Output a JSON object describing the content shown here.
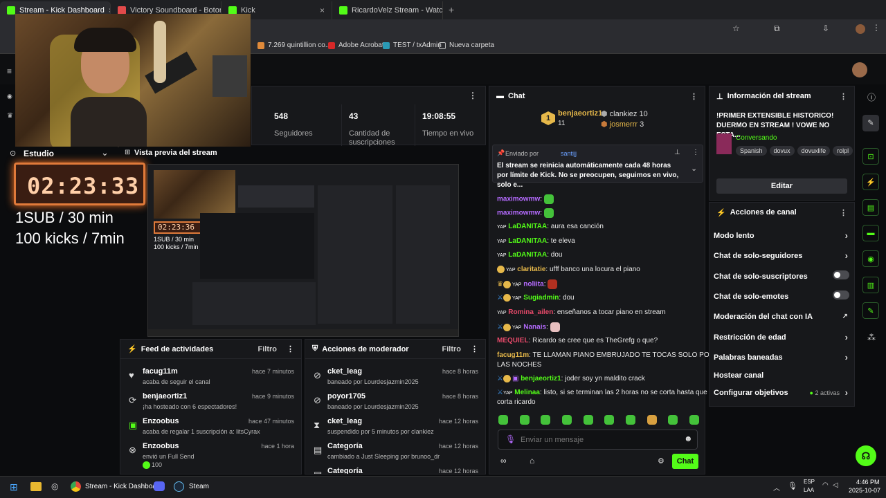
{
  "browser": {
    "tabs": [
      {
        "title": "Stream - Kick Dashboard",
        "active": true
      },
      {
        "title": "Victory Soundboard - Botones",
        "active": false
      },
      {
        "title": "Kick",
        "active": false
      },
      {
        "title": "RicardoVelz Stream - Watch",
        "active": false
      }
    ],
    "bookmarks": [
      "7.269 quintillion co...",
      "Adobe Acrobat",
      "TEST / txAdmin",
      "Nueva carpeta"
    ]
  },
  "stats": {
    "followers_value": "548",
    "followers_label": "Seguidores",
    "subs_value": "43",
    "subs_label": "Cantidad de suscripciones",
    "live_value": "19:08:55",
    "live_label": "Tiempo en vivo"
  },
  "overlay": {
    "studio_label": "Estudio",
    "preview_title": "Vista previa del stream",
    "timer": "02:23:33",
    "line1": "1SUB / 30 min",
    "line2": "100 kicks / 7min",
    "mini_timer": "02:23:36",
    "mini_line1": "1SUB / 30 min",
    "mini_line2": "100 kicks / 7min"
  },
  "activity_feed": {
    "title": "Feed de actividades",
    "filter": "Filtro",
    "items": [
      {
        "icon": "heart-icon",
        "user": "facug11m",
        "text": "acaba de seguir el canal",
        "time": "hace 7 minutos"
      },
      {
        "icon": "host-icon",
        "user": "benjaeortiz1",
        "text": "¡ha hosteado con 6 espectadores!",
        "time": "hace 9 minutos"
      },
      {
        "icon": "gift-icon",
        "user": "Enzoobus",
        "text": "acaba de regalar 1 suscripción a: litsCyrax",
        "time": "hace 47 minutos"
      },
      {
        "icon": "kick-icon",
        "user": "Enzoobus",
        "text": "envió un Full Send",
        "extra": "100",
        "time": "hace 1 hora"
      }
    ]
  },
  "mod_actions": {
    "title": "Acciones de moderador",
    "filter": "Filtro",
    "items": [
      {
        "icon": "ban-icon",
        "user": "cket_leag",
        "text": "baneado por Lourdesjazmin2025",
        "time": "hace 8 horas"
      },
      {
        "icon": "ban-icon",
        "user": "poyor1705",
        "text": "baneado por Lourdesjazmin2025",
        "time": "hace 8 horas"
      },
      {
        "icon": "hourglass-icon",
        "user": "cket_leag",
        "text": "suspendido por 5 minutos por clankiez",
        "time": "hace 12 horas"
      },
      {
        "icon": "category-icon",
        "user": "Categoría",
        "text": "cambiado a Just Sleeping por brunoo_dr",
        "time": "hace 12 horas"
      },
      {
        "icon": "category-icon",
        "user": "Categoría",
        "text": "",
        "time": "hace 12 horas"
      }
    ]
  },
  "chat": {
    "title": "Chat",
    "top_gifters": [
      {
        "rank": "1",
        "name": "benjaeortiz1",
        "count": "11"
      },
      {
        "rank": "",
        "name": "clankiez",
        "count": "10"
      },
      {
        "rank": "",
        "name": "josmerrr",
        "count": "3"
      }
    ],
    "pinned_by_label": "Enviado por",
    "pinned_by": "santijj",
    "pinned_text": "El stream se reinicia automáticamente cada 48 horas por límite de Kick. No se preocupen, seguimos en vivo, solo e...",
    "messages": [
      {
        "user": "maximowmw",
        "text": "",
        "color": "#b56bff",
        "emote": true
      },
      {
        "user": "maximowmw",
        "text": "",
        "color": "#b56bff",
        "emote": true
      },
      {
        "user": "LaDANITAA",
        "text": "aura esa canción",
        "color": "#53fc18"
      },
      {
        "user": "LaDANITAA",
        "text": "te eleva",
        "color": "#53fc18"
      },
      {
        "user": "LaDANITAA",
        "text": "dou",
        "color": "#53fc18"
      },
      {
        "user": "claritatie",
        "text": "ufff banco una locura el piano",
        "color": "#e6b84a"
      },
      {
        "user": "noliita",
        "text": "",
        "color": "#b56bff",
        "emote": true
      },
      {
        "user": "Sugiadmin",
        "text": "dou",
        "color": "#53fc18"
      },
      {
        "user": "Romina_ailen",
        "text": "enseñanos a tocar piano en stream",
        "color": "#e84a6a"
      },
      {
        "user": "Nanais",
        "text": "",
        "color": "#b56bff",
        "emote": true
      },
      {
        "user": "MEQUIEL",
        "text": "Ricardo se cree que es TheGrefg o que?",
        "color": "#e84a6a"
      },
      {
        "user": "facug11m",
        "text": "TE LLAMAN PIANO EMBRUJADO TE TOCAS SOLO POR",
        "text2": "LAS NOCHES",
        "color": "#e6b84a"
      },
      {
        "user": "benjaeortiz1",
        "text": "joder soy yn maldito crack",
        "color": "#53fc18"
      },
      {
        "user": "Melinaa",
        "text": "listo, si se terminan las 2 horas no se corta hasta que",
        "text2": "corta ricardo",
        "color": "#53fc18"
      }
    ],
    "input_placeholder": "Enviar un mensaje",
    "send_label": "Chat"
  },
  "stream_info": {
    "title": "Información del stream",
    "stream_title": "!PRIMER EXTENSIBLE HISTORICO! DUERMO EN STREAM ! VOWE NO ESTA...",
    "category": "Conversando",
    "tags": [
      "Spanish",
      "dovux",
      "dovuxlife",
      "rolpl"
    ],
    "edit_label": "Editar"
  },
  "channel_actions": {
    "title": "Acciones de canal",
    "items": [
      {
        "label": "Modo lento",
        "control": "chevron"
      },
      {
        "label": "Chat de solo-seguidores",
        "control": "chevron"
      },
      {
        "label": "Chat de solo-suscriptores",
        "control": "toggle"
      },
      {
        "label": "Chat de solo-emotes",
        "control": "toggle"
      },
      {
        "label": "Moderación del chat con IA",
        "control": "external"
      },
      {
        "label": "Restricción de edad",
        "control": "chevron"
      },
      {
        "label": "Palabras baneadas",
        "control": "chevron"
      },
      {
        "label": "Hostear canal",
        "control": "none"
      },
      {
        "label": "Configurar objetivos",
        "control": "chevron",
        "extra": "2 activas"
      }
    ]
  },
  "taskbar": {
    "app_label": "Stream - Kick Dashboard",
    "steam_label": "Steam",
    "lang1": "ESP",
    "lang2": "LAA",
    "time": "4:46 PM",
    "date": "2025-10-07"
  }
}
